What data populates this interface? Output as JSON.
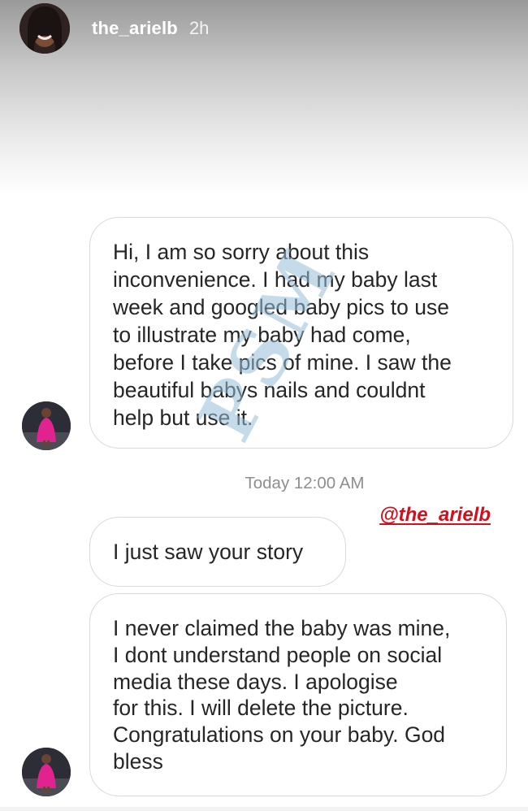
{
  "story": {
    "username": "the_arielb",
    "time": "2h"
  },
  "messages": [
    {
      "lines": [
        "Hi, I am so sorry about this",
        "inconvenience. I had my baby last",
        "week and googled baby pics to use",
        "to illustrate my baby had come,",
        "before I take pics of mine. I saw the",
        "beautiful babys nails and couldnt",
        "help but use it."
      ]
    },
    {
      "text": "I just saw your story"
    },
    {
      "lines": [
        "I never claimed the baby was mine,",
        "I dont understand people on social",
        "media these days. I apologise",
        "for this. I will delete the picture.",
        "Congratulations on your baby. God",
        "bless"
      ]
    }
  ],
  "timestamp": "Today 12:00 AM",
  "mention": "@the_arielb",
  "watermark": "PSM",
  "colors": {
    "mention": "#d0101c",
    "timestamp": "#8e8e8e",
    "bubble_border": "#d9d9d9",
    "message_text": "#262626"
  }
}
